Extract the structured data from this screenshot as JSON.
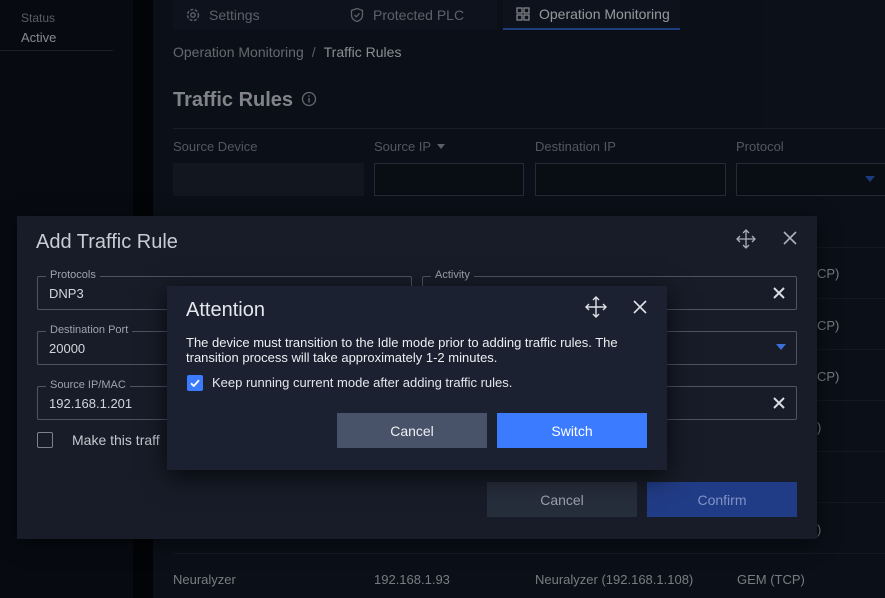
{
  "sidebar": {
    "status_label": "Status",
    "status_value": "Active"
  },
  "tabs": [
    {
      "label": "Settings",
      "icon": "gear-icon"
    },
    {
      "label": "Protected PLC",
      "icon": "shield-icon"
    },
    {
      "label": "Operation Monitoring",
      "icon": "dashboard-icon",
      "active": true
    }
  ],
  "breadcrumb": {
    "parent": "Operation Monitoring",
    "separator": "/",
    "current": "Traffic Rules"
  },
  "page": {
    "title": "Traffic Rules",
    "filters": {
      "source_device": "Source Device",
      "source_ip": "Source IP",
      "destination_ip": "Destination IP",
      "protocol": "Protocol"
    },
    "protocol_suffixes": [
      "CP)",
      "CP)",
      "CP)",
      ")",
      ")"
    ],
    "last_row": {
      "device": "Neuralyzer",
      "source_ip": "192.168.1.93",
      "destination": "Neuralyzer (192.168.1.108)",
      "protocol": "GEM (TCP)"
    }
  },
  "add_rule_dialog": {
    "title": "Add Traffic Rule",
    "protocols_label": "Protocols",
    "protocols_value": "DNP3",
    "activity_label": "Activity",
    "destination_port_label": "Destination Port",
    "destination_port_value": "20000",
    "source_ip_label": "Source IP/MAC",
    "source_ip_value": "192.168.1.201",
    "checkbox_label": "Make this traff",
    "cancel_label": "Cancel",
    "confirm_label": "Confirm"
  },
  "attention_dialog": {
    "title": "Attention",
    "message": "The device must transition to the Idle mode prior to adding traffic rules. The transition process will take approximately 1-2 minutes.",
    "checkbox_label": "Keep running current mode after adding traffic rules.",
    "checkbox_checked": true,
    "cancel_label": "Cancel",
    "switch_label": "Switch"
  },
  "colors": {
    "accent": "#3a7bff",
    "confirm_disabled": "#213c86",
    "background": "#121826"
  }
}
